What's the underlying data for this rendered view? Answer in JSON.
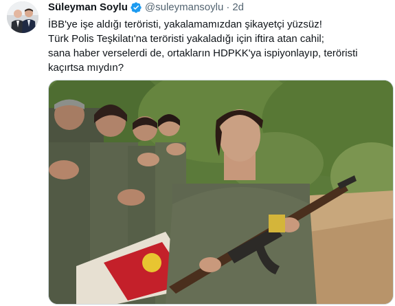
{
  "author": {
    "display_name": "Süleyman Soylu",
    "handle": "@suleymansoylu",
    "separator": "·",
    "time": "2d",
    "verified_icon": "verified-badge-icon"
  },
  "tweet": {
    "lines": [
      "İBB'ye işe aldığı teröristi, yakalamamızdan şikayetçi yüzsüz!",
      "Türk Polis Teşkilatı'na teröristi yakaladığı için iftira atan cahil;",
      "sana haber verselerdi de, ortakların HDPKK'ya ispiyonlayıp, teröristi",
      "kaçırtsa mıydın?"
    ]
  },
  "media": {
    "kind": "photo",
    "description_icon": "photo-attachment"
  },
  "colors": {
    "text": "#0f1419",
    "secondary": "#536471",
    "verified": "#1d9bf0",
    "border": "#cfd9de"
  }
}
